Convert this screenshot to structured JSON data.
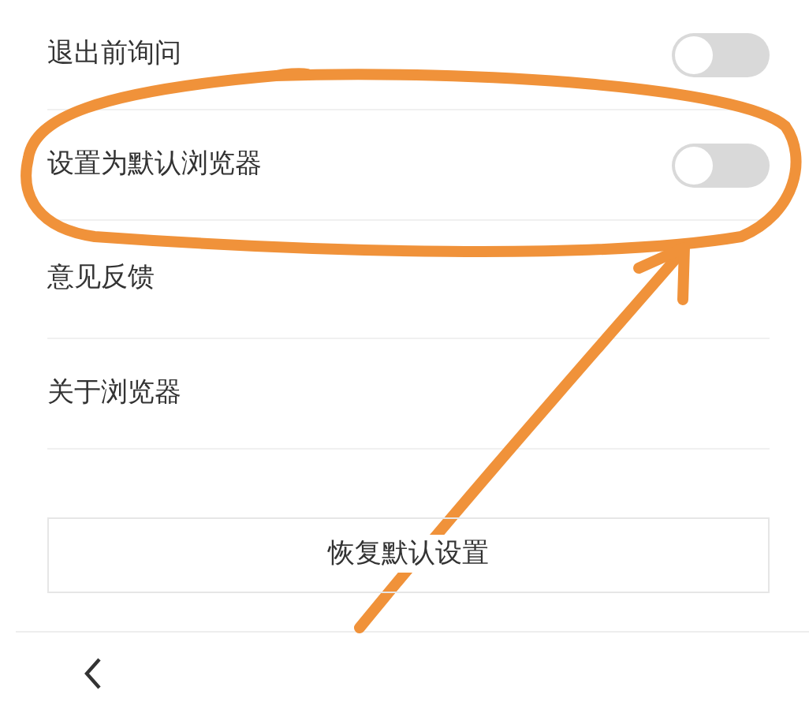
{
  "settings": [
    {
      "kind": "toggle",
      "label": "退出前询问",
      "on": false
    },
    {
      "kind": "toggle",
      "label": "设置为默认浏览器",
      "on": false
    },
    {
      "kind": "link",
      "label": "意见反馈"
    },
    {
      "kind": "link",
      "label": "关于浏览器"
    }
  ],
  "reset_button": "恢复默认设置"
}
